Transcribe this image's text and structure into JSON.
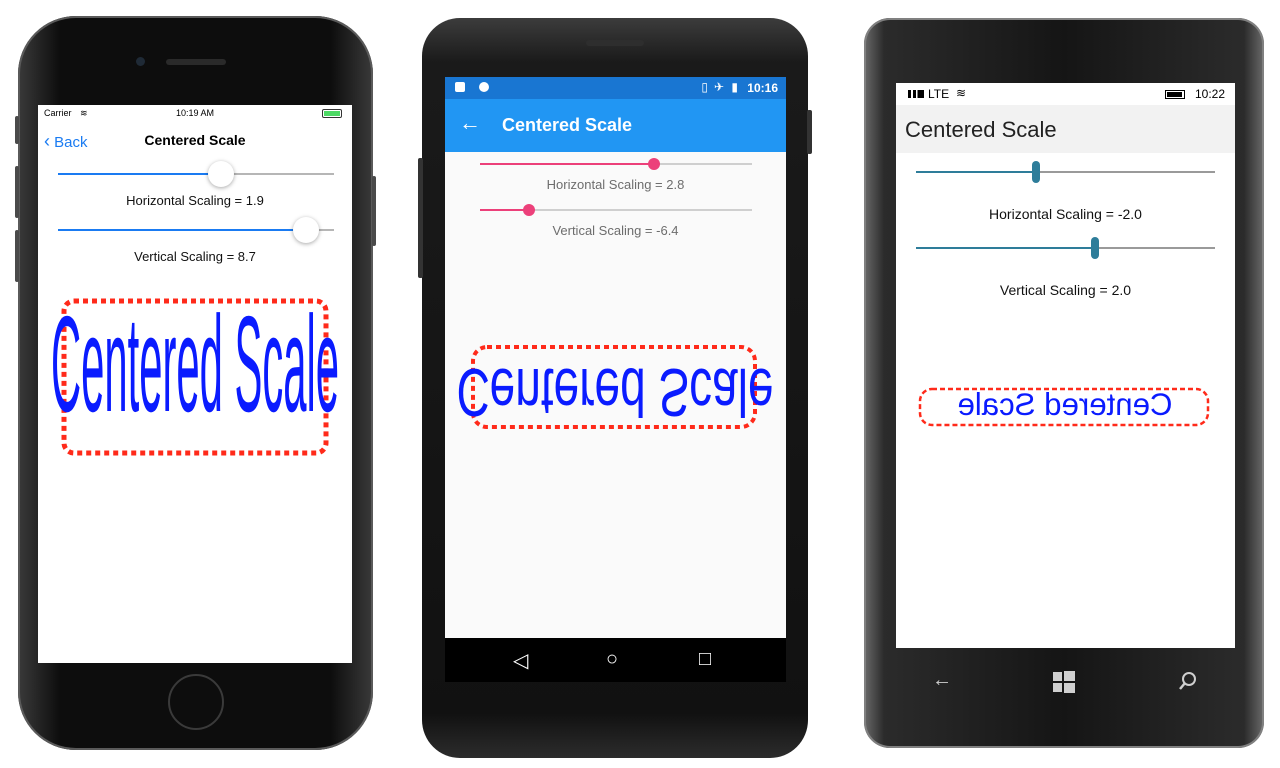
{
  "iphone": {
    "status": {
      "carrier": "Carrier",
      "time": "10:19 AM"
    },
    "nav": {
      "back_label": "Back",
      "title": "Centered Scale"
    },
    "horizontal_label": "Horizontal Scaling = 1.9",
    "vertical_label": "Vertical Scaling = 8.7",
    "horizontal_value": 1.9,
    "vertical_value": 8.7,
    "horizontal_slider_fraction": 0.59,
    "vertical_slider_fraction": 0.9,
    "sample_text": "Centered Scale"
  },
  "android": {
    "status": {
      "time": "10:16"
    },
    "appbar": {
      "back_icon": "arrow-left-icon",
      "title": "Centered Scale"
    },
    "horizontal_label": "Horizontal Scaling = 2.8",
    "vertical_label": "Vertical Scaling = -6.4",
    "horizontal_value": 2.8,
    "vertical_value": -6.4,
    "horizontal_slider_fraction": 0.64,
    "vertical_slider_fraction": 0.18,
    "sample_text": "Centered Scale",
    "navbar": {
      "back": "◁",
      "home": "○",
      "recent": "□"
    }
  },
  "winphone": {
    "status": {
      "network": "LTE",
      "time": "10:22"
    },
    "header_title": "Centered Scale",
    "horizontal_label": "Horizontal Scaling = -2.0",
    "vertical_label": "Vertical Scaling = 2.0",
    "horizontal_value": -2.0,
    "vertical_value": 2.0,
    "horizontal_slider_fraction": 0.4,
    "vertical_slider_fraction": 0.6,
    "sample_text": "Centered Scale",
    "navbar": {
      "back": "←",
      "start": "start-icon",
      "search": "search-icon"
    }
  },
  "colors": {
    "text_blue": "#0a1bff",
    "frame_red": "#ff2a1a",
    "ios_blue": "#1a7bf2",
    "android_blue": "#2196f3",
    "android_pink": "#ec407a",
    "wp_teal": "#2e7d9a"
  }
}
